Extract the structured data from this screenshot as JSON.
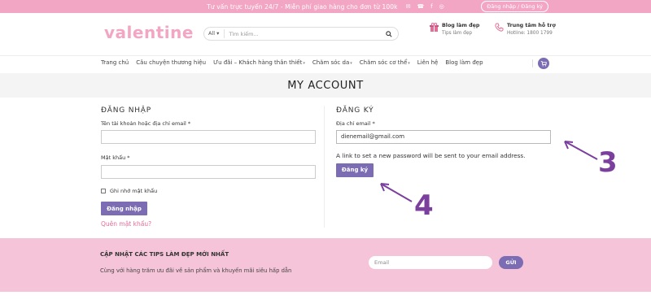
{
  "topbar": {
    "promo": "Tư vấn trực tuyến 24/7 - Miễn phí giao hàng cho đơn từ 100k",
    "login_register": "Đăng nhập / Đăng ký"
  },
  "header": {
    "logo": "valentine",
    "search": {
      "category": "All",
      "placeholder": "Tìm kiếm..."
    },
    "blog": {
      "title": "Blog làm đẹp",
      "subtitle": "Tips làm đẹp"
    },
    "support": {
      "title": "Trung tâm hỗ trợ",
      "subtitle": "Hotline: 1800 1799"
    }
  },
  "nav": {
    "items": [
      {
        "label": "Trang chủ",
        "caret": ""
      },
      {
        "label": "Câu chuyện thương hiệu",
        "caret": ""
      },
      {
        "label": "Ưu đãi – Khách hàng thân thiết",
        "caret": "▾"
      },
      {
        "label": "Chăm sóc da",
        "caret": "▾"
      },
      {
        "label": "Chăm sóc cơ thể",
        "caret": "▾"
      },
      {
        "label": "Liên hệ",
        "caret": ""
      },
      {
        "label": "Blog làm đẹp",
        "caret": ""
      }
    ]
  },
  "page_title": "MY ACCOUNT",
  "login": {
    "heading": "ĐĂNG NHẬP",
    "username_label": "Tên tài khoản hoặc địa chỉ email *",
    "password_label": "Mật khẩu *",
    "remember_label": "Ghi nhớ mật khẩu",
    "submit_label": "Đăng nhập",
    "lost_password": "Quên mật khẩu?"
  },
  "register": {
    "heading": "ĐĂNG KÝ",
    "email_label": "Địa chỉ email *",
    "email_value": "dienemail@gmail.com",
    "note": "A link to set a new password will be sent to your email address.",
    "submit_label": "Đăng ký"
  },
  "annotations": {
    "step3": "3",
    "step4": "4"
  },
  "footer": {
    "title": "CẬP NHẬT CÁC TIPS LÀM ĐẸP MỚI NHẤT",
    "desc": "Cùng với hàng trăm ưu đãi về sản phẩm và khuyến mãi siêu hấp dẫn",
    "email_placeholder": "Email",
    "send_label": "GỬI"
  },
  "colors": {
    "pink": "#f2a6c3",
    "accent": "#7b6cb4",
    "footer_bg": "#f6c4d8",
    "annotation": "#7b3f9e"
  }
}
